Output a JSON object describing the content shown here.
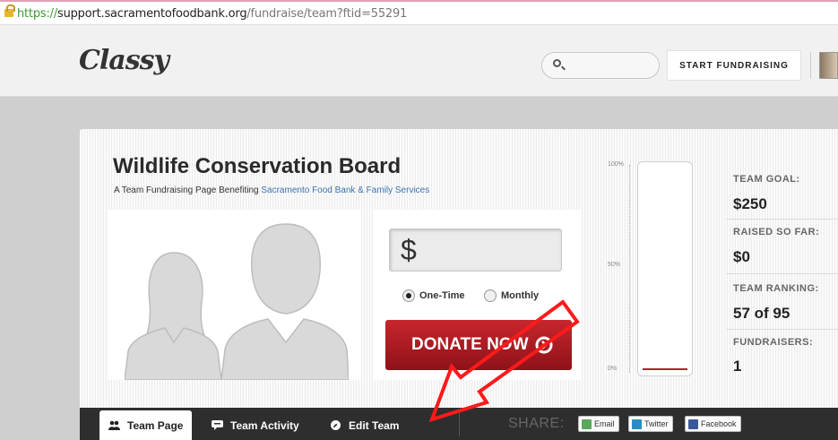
{
  "browser": {
    "url_protocol": "https://",
    "url_host": "support.sacramentofoodbank.org",
    "url_path": "/fundraise/team?ftid=55291"
  },
  "header": {
    "logo": "Classy",
    "search_placeholder": "",
    "start_fundraising": "START FUNDRAISING"
  },
  "team": {
    "title": "Wildlife Conservation Board",
    "subtitle_prefix": "A Team Fundraising Page Benefiting ",
    "subtitle_link": "Sacramento Food Bank & Family Services"
  },
  "donate": {
    "currency_symbol": "$",
    "amount_value": "",
    "frequency_options": [
      {
        "label": "One-Time",
        "selected": true
      },
      {
        "label": "Monthly",
        "selected": false
      }
    ],
    "button_label": "DONATE NOW",
    "button_icon": "chevron-right-circle-icon"
  },
  "progress": {
    "labels": [
      "100%",
      "50%",
      "0%"
    ],
    "fraction": 0
  },
  "stats": [
    {
      "label": "TEAM GOAL:",
      "value": "$250"
    },
    {
      "label": "RAISED SO FAR:",
      "value": "$0"
    },
    {
      "label": "TEAM RANKING:",
      "value": "57 of 95"
    },
    {
      "label": "FUNDRAISERS:",
      "value": "1"
    }
  ],
  "tabs": [
    {
      "label": "Team Page",
      "icon": "users-icon",
      "active": true
    },
    {
      "label": "Team Activity",
      "icon": "chat-icon",
      "active": false
    },
    {
      "label": "Edit Team",
      "icon": "wrench-icon",
      "active": false
    }
  ],
  "share": {
    "label": "SHARE:",
    "buttons": [
      {
        "label": "Email",
        "icon": "email-icon",
        "color": "#5aa85a"
      },
      {
        "label": "Twitter",
        "icon": "twitter-icon",
        "color": "#2b8cc4"
      },
      {
        "label": "Facebook",
        "icon": "facebook-icon",
        "color": "#3b5998"
      }
    ]
  },
  "colors": {
    "donate_button": "#b01f27",
    "annotation_arrow": "#ff1a1a",
    "link": "#3b73b0",
    "tabbar": "#2e2e2e"
  }
}
